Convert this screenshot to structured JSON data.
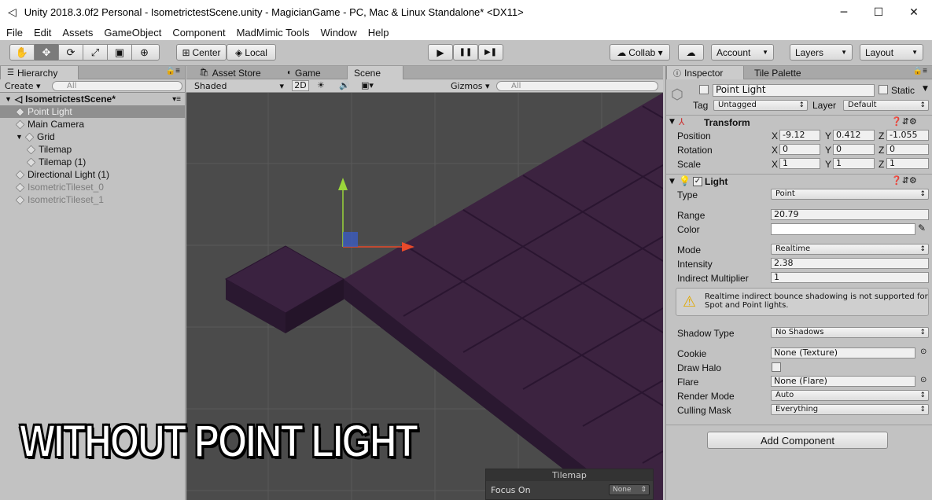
{
  "window": {
    "title": "Unity 2018.3.0f2 Personal - IsometrictestScene.unity - MagicianGame - PC, Mac & Linux Standalone* <DX11>",
    "minimize": "─",
    "maximize": "☐",
    "close": "✕"
  },
  "menu": [
    "File",
    "Edit",
    "Assets",
    "GameObject",
    "Component",
    "MadMimic Tools",
    "Window",
    "Help"
  ],
  "toolbar": {
    "tools": [
      "✋",
      "✥",
      "⟳",
      "⤢",
      "▣",
      "⊕"
    ],
    "pivot": "Center",
    "space": "Local",
    "play": "▶",
    "pause": "❚❚",
    "step": "▶❚",
    "collab": "Collab ▾",
    "cloud": "☁",
    "account": "Account",
    "layers": "Layers",
    "layout": "Layout"
  },
  "hierarchy": {
    "tab": "Hierarchy",
    "create": "Create",
    "search_placeholder": "All",
    "scene": "IsometrictestScene*",
    "items": [
      {
        "label": "Point Light",
        "indent": 1,
        "selected": true,
        "dim": false
      },
      {
        "label": "Main Camera",
        "indent": 1,
        "selected": false,
        "dim": false
      },
      {
        "label": "Grid",
        "indent": 1,
        "selected": false,
        "dim": false,
        "expanded": true
      },
      {
        "label": "Tilemap",
        "indent": 2,
        "selected": false,
        "dim": false
      },
      {
        "label": "Tilemap (1)",
        "indent": 2,
        "selected": false,
        "dim": false
      },
      {
        "label": "Directional Light (1)",
        "indent": 1,
        "selected": false,
        "dim": false
      },
      {
        "label": "IsometricTileset_0",
        "indent": 1,
        "selected": false,
        "dim": true
      },
      {
        "label": "IsometricTileset_1",
        "indent": 1,
        "selected": false,
        "dim": true
      }
    ]
  },
  "scene_tabs": {
    "asset_store": "Asset Store",
    "game": "Game",
    "scene": "Scene"
  },
  "scene_bar": {
    "shading": "Shaded",
    "mode2d": "2D",
    "gizmos": "Gizmos",
    "search_placeholder": "All"
  },
  "tilemap_overlay": {
    "title": "Tilemap",
    "focus_label": "Focus On",
    "focus_value": "None"
  },
  "caption": "WITHOUT POINT LIGHT",
  "inspector": {
    "tab": "Inspector",
    "tab2": "Tile Palette",
    "object_name": "Point Light",
    "static_label": "Static",
    "tag_label": "Tag",
    "tag_value": "Untagged",
    "layer_label": "Layer",
    "layer_value": "Default",
    "transform": {
      "title": "Transform",
      "position_label": "Position",
      "position": {
        "x": "-9.12",
        "y": "0.412",
        "z": "-1.055"
      },
      "rotation_label": "Rotation",
      "rotation": {
        "x": "0",
        "y": "0",
        "z": "0"
      },
      "scale_label": "Scale",
      "scale": {
        "x": "1",
        "y": "1",
        "z": "1"
      }
    },
    "light": {
      "title": "Light",
      "type_label": "Type",
      "type": "Point",
      "range_label": "Range",
      "range": "20.79",
      "color_label": "Color",
      "mode_label": "Mode",
      "mode": "Realtime",
      "intensity_label": "Intensity",
      "intensity": "2.38",
      "indirect_label": "Indirect Multiplier",
      "indirect": "1",
      "warning": "Realtime indirect bounce shadowing is not supported for Spot and Point lights.",
      "shadow_label": "Shadow Type",
      "shadow": "No Shadows",
      "cookie_label": "Cookie",
      "cookie": "None (Texture)",
      "halo_label": "Draw Halo",
      "flare_label": "Flare",
      "flare": "None (Flare)",
      "render_label": "Render Mode",
      "render": "Auto",
      "culling_label": "Culling Mask",
      "culling": "Everything"
    },
    "add_component": "Add Component"
  },
  "colors": {
    "selection": "#8f8f8f",
    "scene_bg": "#4a4a4a",
    "tile_top": "#3d2640",
    "tile_side": "#2b1a30"
  }
}
